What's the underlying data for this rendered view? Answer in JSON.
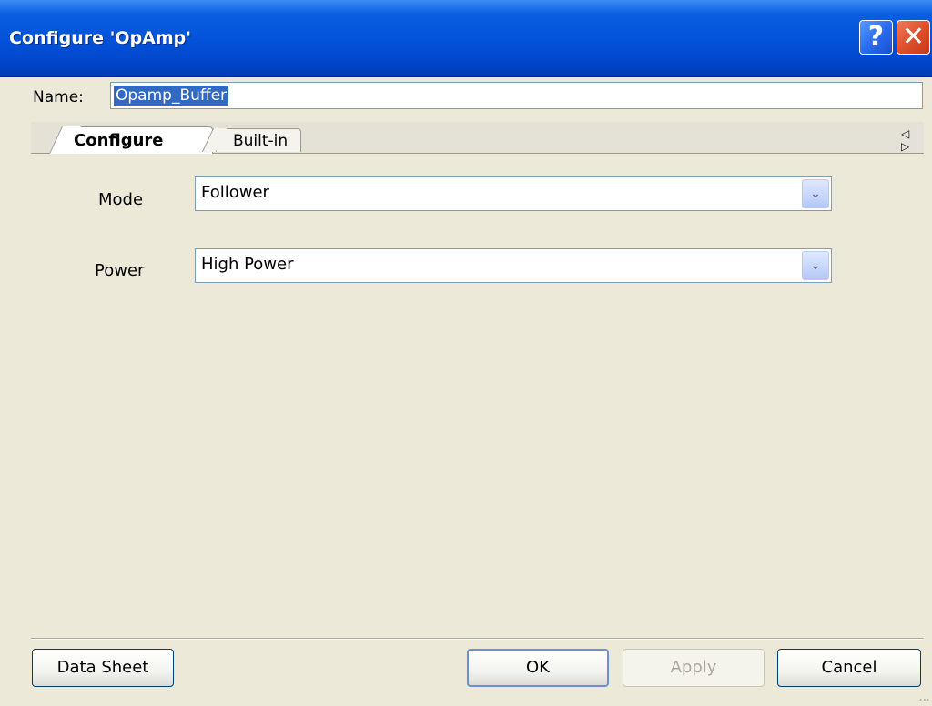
{
  "window": {
    "title": "Configure 'OpAmp'",
    "help_glyph": "?",
    "close_glyph": "✕"
  },
  "name_row": {
    "label": "Name:",
    "value": "Opamp_Buffer"
  },
  "tabs": [
    {
      "label": "Configure",
      "active": true
    },
    {
      "label": "Built-in",
      "active": false
    }
  ],
  "tab_scroll": "◁ ▷",
  "fields": {
    "mode": {
      "label": "Mode",
      "value": "Follower"
    },
    "power": {
      "label": "Power",
      "value": "High Power"
    }
  },
  "dropdown_glyph": "⌄",
  "buttons": {
    "datasheet": "Data Sheet",
    "ok": "OK",
    "apply": "Apply",
    "cancel": "Cancel"
  },
  "colors": {
    "titlebar": "#0351d8",
    "dialog_bg": "#ece9d8",
    "selection": "#316ac5"
  }
}
